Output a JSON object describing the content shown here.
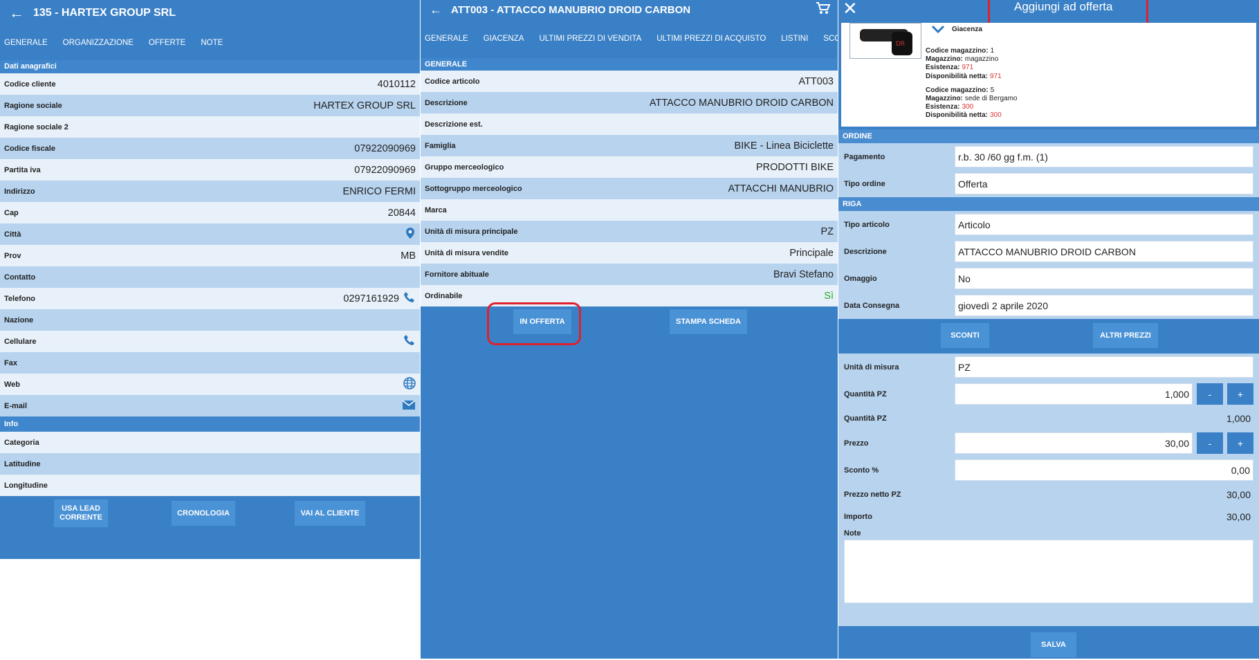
{
  "panel1": {
    "title": "135 - HARTEX GROUP SRL",
    "tabs": [
      "GENERALE",
      "ORGANIZZAZIONE",
      "OFFERTE",
      "NOTE"
    ],
    "sections": {
      "anag": "Dati anagrafici",
      "info": "Info"
    },
    "fields": [
      {
        "label": "Codice cliente",
        "value": "4010112"
      },
      {
        "label": "Ragione sociale",
        "value": "HARTEX GROUP SRL"
      },
      {
        "label": "Ragione sociale 2",
        "value": ""
      },
      {
        "label": "Codice fiscale",
        "value": "07922090969"
      },
      {
        "label": "Partita iva",
        "value": "07922090969"
      },
      {
        "label": "Indirizzo",
        "value": "ENRICO FERMI"
      },
      {
        "label": "Cap",
        "value": "20844"
      },
      {
        "label": "Città",
        "value": ""
      },
      {
        "label": "Prov",
        "value": "MB"
      },
      {
        "label": "Contatto",
        "value": ""
      },
      {
        "label": "Telefono",
        "value": "0297161929"
      },
      {
        "label": "Nazione",
        "value": ""
      },
      {
        "label": "Cellulare",
        "value": ""
      },
      {
        "label": "Fax",
        "value": ""
      },
      {
        "label": "Web",
        "value": ""
      },
      {
        "label": "E-mail",
        "value": ""
      }
    ],
    "info": [
      {
        "label": "Categoria",
        "value": ""
      },
      {
        "label": "Latitudine",
        "value": ""
      },
      {
        "label": "Longitudine",
        "value": ""
      }
    ],
    "buttons": {
      "lead": "USA LEAD CORRENTE",
      "crono": "CRONOLOGIA",
      "vai": "VAI AL CLIENTE"
    }
  },
  "panel2": {
    "title": "ATT003 - ATTACCO MANUBRIO DROID CARBON",
    "tabs": [
      "GENERALE",
      "GIACENZA",
      "ULTIMI PREZZI DI VENDITA",
      "ULTIMI PREZZI DI ACQUISTO",
      "LISTINI",
      "SCONTI"
    ],
    "section": "GENERALE",
    "fields": [
      {
        "label": "Codice articolo",
        "value": "ATT003"
      },
      {
        "label": "Descrizione",
        "value": "ATTACCO MANUBRIO DROID CARBON"
      },
      {
        "label": "Descrizione est.",
        "value": ""
      },
      {
        "label": "Famiglia",
        "value": "BIKE - Linea Biciclette"
      },
      {
        "label": "Gruppo merceologico",
        "value": "PRODOTTI BIKE"
      },
      {
        "label": "Sottogruppo merceologico",
        "value": "ATTACCHI MANUBRIO"
      },
      {
        "label": "Marca",
        "value": ""
      },
      {
        "label": "Unità di misura principale",
        "value": "PZ"
      },
      {
        "label": "Unità di misura vendite",
        "value": "Principale"
      },
      {
        "label": "Fornitore abituale",
        "value": "Bravi Stefano"
      },
      {
        "label": "Ordinabile",
        "value": "Sì"
      }
    ],
    "buttons": {
      "offerta": "IN OFFERTA",
      "stampa": "STAMPA SCHEDA"
    }
  },
  "panel3": {
    "title": "Aggiungi ad offerta",
    "giacenza": "Giacenza",
    "stock": [
      {
        "codice_l": "Codice magazzino:",
        "codice": "1",
        "mag_l": "Magazzino:",
        "mag": "magazzino",
        "es_l": "Esistenza:",
        "es": "971",
        "disp_l": "Disponibilità netta:",
        "disp": "971"
      },
      {
        "codice_l": "Codice magazzino:",
        "codice": "5",
        "mag_l": "Magazzino:",
        "mag": "sede di Bergamo",
        "es_l": "Esistenza:",
        "es": "300",
        "disp_l": "Disponibilità netta:",
        "disp": "300"
      }
    ],
    "ordine": "ORDINE",
    "pagamento_l": "Pagamento",
    "pagamento": "r.b. 30 /60 gg f.m. (1)",
    "tipo_ordine_l": "Tipo ordine",
    "tipo_ordine": "Offerta",
    "riga": "RIGA",
    "tipo_art_l": "Tipo articolo",
    "tipo_art": "Articolo",
    "descr_l": "Descrizione",
    "descr": "ATTACCO MANUBRIO DROID CARBON",
    "omaggio_l": "Omaggio",
    "omaggio": "No",
    "data_l": "Data Consegna",
    "data": "giovedì 2 aprile 2020",
    "sconti": "SCONTI",
    "altri": "ALTRI PREZZI",
    "um_l": "Unità di misura",
    "um": "PZ",
    "qta_l": "Quantità PZ",
    "qta": "1,000",
    "qta2_l": "Quantità PZ",
    "qta2": "1,000",
    "prezzo_l": "Prezzo",
    "prezzo": "30,00",
    "sconto_l": "Sconto %",
    "sconto": "0,00",
    "netto_l": "Prezzo netto PZ",
    "netto": "30,00",
    "importo_l": "Importo",
    "importo": "30,00",
    "note_l": "Note",
    "minus": "-",
    "plus": "+",
    "salva": "SALVA"
  }
}
